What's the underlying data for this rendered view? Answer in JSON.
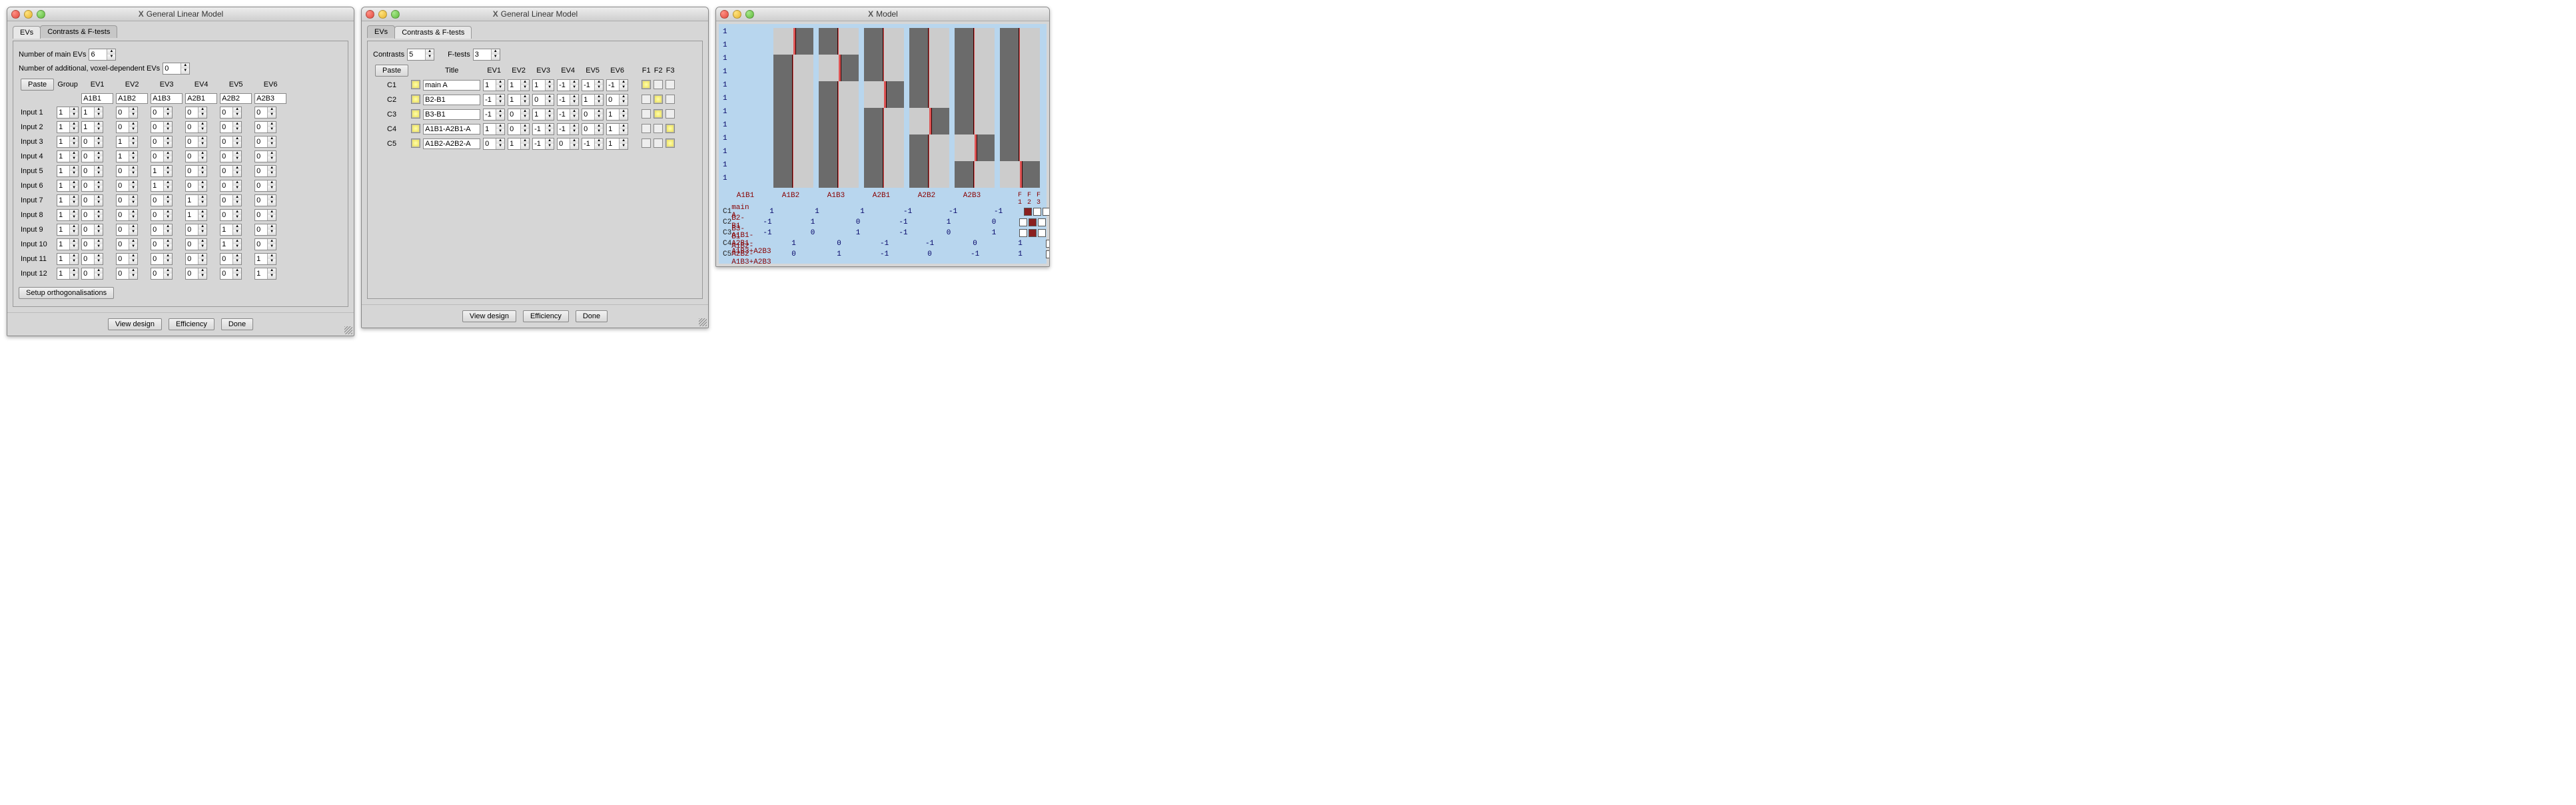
{
  "window1": {
    "title": "General Linear Model",
    "tabs": [
      "EVs",
      "Contrasts & F-tests"
    ],
    "active_tab": 0,
    "num_main_evs_label": "Number of main EVs",
    "num_main_evs": "6",
    "num_addl_label": "Number of additional, voxel-dependent EVs",
    "num_addl": "0",
    "paste": "Paste",
    "group_header": "Group",
    "ev_headers": [
      "EV1",
      "EV2",
      "EV3",
      "EV4",
      "EV5",
      "EV6"
    ],
    "ev_labels": [
      "A1B1",
      "A1B2",
      "A1B3",
      "A2B1",
      "A2B2",
      "A2B3"
    ],
    "inputs": [
      {
        "name": "Input 1",
        "group": "1",
        "ev": [
          "1",
          "0",
          "0",
          "0",
          "0",
          "0"
        ]
      },
      {
        "name": "Input 2",
        "group": "1",
        "ev": [
          "1",
          "0",
          "0",
          "0",
          "0",
          "0"
        ]
      },
      {
        "name": "Input 3",
        "group": "1",
        "ev": [
          "0",
          "1",
          "0",
          "0",
          "0",
          "0"
        ]
      },
      {
        "name": "Input 4",
        "group": "1",
        "ev": [
          "0",
          "1",
          "0",
          "0",
          "0",
          "0"
        ]
      },
      {
        "name": "Input 5",
        "group": "1",
        "ev": [
          "0",
          "0",
          "1",
          "0",
          "0",
          "0"
        ]
      },
      {
        "name": "Input 6",
        "group": "1",
        "ev": [
          "0",
          "0",
          "1",
          "0",
          "0",
          "0"
        ]
      },
      {
        "name": "Input 7",
        "group": "1",
        "ev": [
          "0",
          "0",
          "0",
          "1",
          "0",
          "0"
        ]
      },
      {
        "name": "Input 8",
        "group": "1",
        "ev": [
          "0",
          "0",
          "0",
          "1",
          "0",
          "0"
        ]
      },
      {
        "name": "Input 9",
        "group": "1",
        "ev": [
          "0",
          "0",
          "0",
          "0",
          "1",
          "0"
        ]
      },
      {
        "name": "Input 10",
        "group": "1",
        "ev": [
          "0",
          "0",
          "0",
          "0",
          "1",
          "0"
        ]
      },
      {
        "name": "Input 11",
        "group": "1",
        "ev": [
          "0",
          "0",
          "0",
          "0",
          "0",
          "1"
        ]
      },
      {
        "name": "Input 12",
        "group": "1",
        "ev": [
          "0",
          "0",
          "0",
          "0",
          "0",
          "1"
        ]
      }
    ],
    "setup_orth": "Setup orthogonalisations",
    "buttons": {
      "view": "View design",
      "eff": "Efficiency",
      "done": "Done"
    }
  },
  "window2": {
    "title": "General Linear Model",
    "tabs": [
      "EVs",
      "Contrasts & F-tests"
    ],
    "active_tab": 1,
    "contrasts_label": "Contrasts",
    "contrasts": "5",
    "ftests_label": "F-tests",
    "ftests": "3",
    "paste": "Paste",
    "title_header": "Title",
    "ev_headers": [
      "EV1",
      "EV2",
      "EV3",
      "EV4",
      "EV5",
      "EV6"
    ],
    "f_headers": [
      "F1",
      "F2",
      "F3"
    ],
    "rows": [
      {
        "id": "C1",
        "on": true,
        "title": "main A",
        "ev": [
          "1",
          "1",
          "1",
          "-1",
          "-1",
          "-1"
        ],
        "f": [
          true,
          false,
          false
        ]
      },
      {
        "id": "C2",
        "on": true,
        "title": "B2-B1",
        "ev": [
          "-1",
          "1",
          "0",
          "-1",
          "1",
          "0"
        ],
        "f": [
          false,
          true,
          false
        ]
      },
      {
        "id": "C3",
        "on": true,
        "title": "B3-B1",
        "ev": [
          "-1",
          "0",
          "1",
          "-1",
          "0",
          "1"
        ],
        "f": [
          false,
          true,
          false
        ]
      },
      {
        "id": "C4",
        "on": true,
        "title": "A1B1-A2B1-A",
        "ev": [
          "1",
          "0",
          "-1",
          "-1",
          "0",
          "1"
        ],
        "f": [
          false,
          false,
          true
        ]
      },
      {
        "id": "C5",
        "on": true,
        "title": "A1B2-A2B2-A",
        "ev": [
          "0",
          "1",
          "-1",
          "0",
          "-1",
          "1"
        ],
        "f": [
          false,
          false,
          true
        ]
      }
    ],
    "buttons": {
      "view": "View design",
      "eff": "Efficiency",
      "done": "Done"
    }
  },
  "window3": {
    "title": "Model",
    "group_values": [
      "1",
      "1",
      "1",
      "1",
      "1",
      "1",
      "1",
      "1",
      "1",
      "1",
      "1",
      "1"
    ],
    "design": [
      [
        "L",
        "",
        "",
        "",
        "",
        ""
      ],
      [
        "L",
        "",
        "",
        "",
        "",
        ""
      ],
      [
        "",
        "L",
        "",
        "",
        "",
        ""
      ],
      [
        "",
        "L",
        "",
        "",
        "",
        ""
      ],
      [
        "",
        "",
        "L",
        "",
        "",
        ""
      ],
      [
        "",
        "",
        "L",
        "",
        "",
        ""
      ],
      [
        "",
        "",
        "",
        "L",
        "",
        ""
      ],
      [
        "",
        "",
        "",
        "L",
        "",
        ""
      ],
      [
        "",
        "",
        "",
        "",
        "L",
        ""
      ],
      [
        "",
        "",
        "",
        "",
        "L",
        ""
      ],
      [
        "",
        "",
        "",
        "",
        "",
        "L"
      ],
      [
        "",
        "",
        "",
        "",
        "",
        "L"
      ]
    ],
    "ev_labels": [
      "A1B1",
      "A1B2",
      "A1B3",
      "A2B1",
      "A2B2",
      "A2B3"
    ],
    "f_labels": [
      "F",
      "F",
      "F"
    ],
    "f_nums": [
      "1",
      "2",
      "3"
    ],
    "contrasts": [
      {
        "id": "C1",
        "name": "main A",
        "vals": [
          "1",
          "1",
          "1",
          "-1",
          "-1",
          "-1"
        ],
        "f": [
          true,
          false,
          false
        ]
      },
      {
        "id": "C2",
        "name": "B2-B1",
        "vals": [
          "-1",
          "1",
          "0",
          "-1",
          "1",
          "0"
        ],
        "f": [
          false,
          true,
          false
        ]
      },
      {
        "id": "C3",
        "name": "B3-B1",
        "vals": [
          "-1",
          "0",
          "1",
          "-1",
          "0",
          "1"
        ],
        "f": [
          false,
          true,
          false
        ]
      },
      {
        "id": "C4",
        "name": "A1B1-A2B1-A1B3+A2B3",
        "vals": [
          "1",
          "0",
          "-1",
          "-1",
          "0",
          "1"
        ],
        "f": [
          false,
          false,
          true
        ]
      },
      {
        "id": "C5",
        "name": "A1B2-A2B2-A1B3+A2B3",
        "vals": [
          "0",
          "1",
          "-1",
          "0",
          "-1",
          "1"
        ],
        "f": [
          false,
          false,
          true
        ]
      }
    ]
  }
}
